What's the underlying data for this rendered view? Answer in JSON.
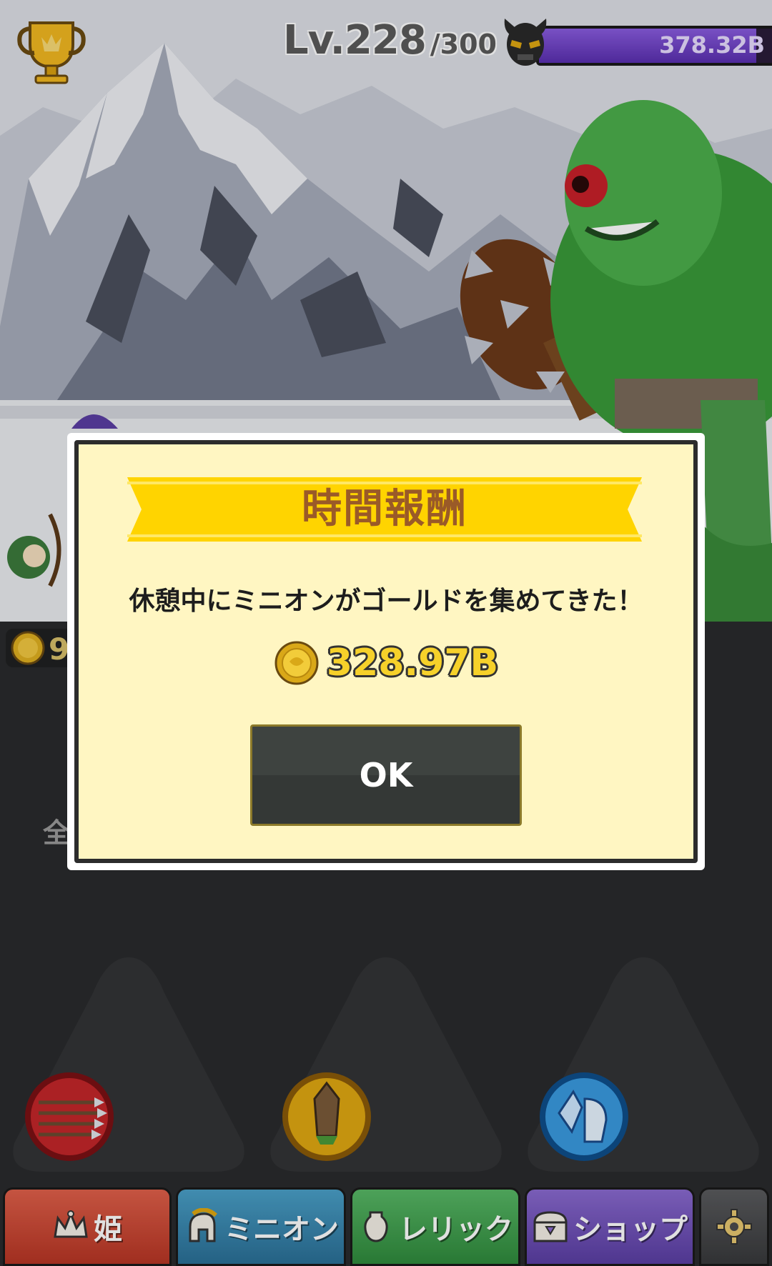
{
  "hud": {
    "level": "Lv.228",
    "level_max": "/300",
    "boss_hp": "378.32B",
    "boss_hp_fill": 0.92
  },
  "coins_partial": "9",
  "side_label_partial": "全",
  "modal": {
    "title": "時間報酬",
    "message": "休憩中にミニオンがゴールドを集めてきた！",
    "reward_amount": "328.97B",
    "ok_label": "OK"
  },
  "tabs": [
    {
      "label": "姫",
      "icon": "crown-icon",
      "color": "#c9402c"
    },
    {
      "label": "ミニオン",
      "icon": "spartan-helmet-icon",
      "color": "#3686b0"
    },
    {
      "label": "レリック",
      "icon": "vase-icon",
      "color": "#3f9c4c"
    },
    {
      "label": "ショップ",
      "icon": "treasure-chest-icon",
      "color": "#6d4fbd"
    },
    {
      "label": "",
      "icon": "gear-icon",
      "color": "#4a4b4d"
    }
  ],
  "skills": [
    {
      "icon": "arrows-icon",
      "color": "#c3262a"
    },
    {
      "icon": "crystal-sword-icon",
      "color": "#e0a812"
    },
    {
      "icon": "ice-armor-icon",
      "color": "#2a8ad0"
    }
  ]
}
